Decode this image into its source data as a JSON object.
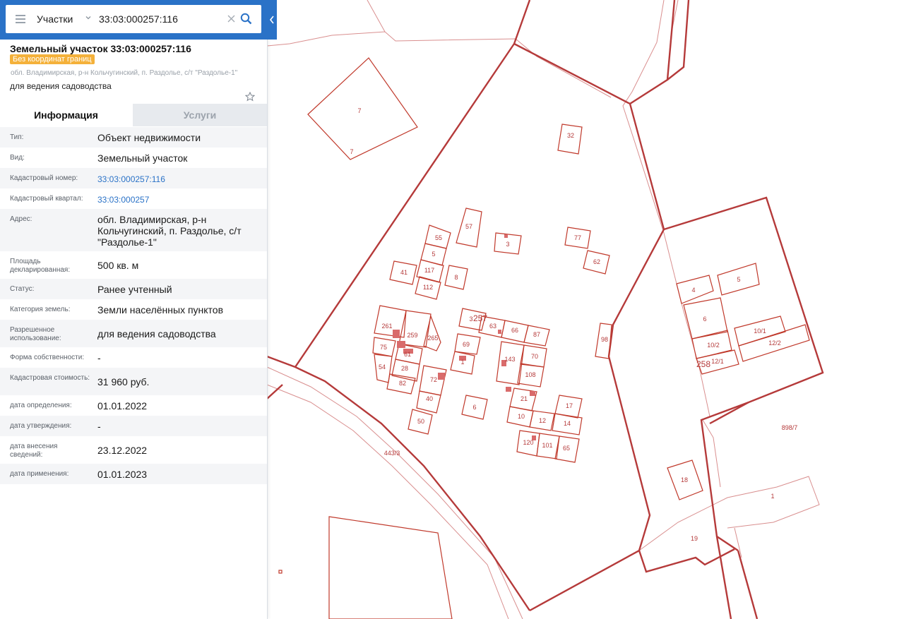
{
  "search": {
    "layer": "Участки",
    "query": "33:03:000257:116"
  },
  "parcel": {
    "title": "Земельный участок 33:03:000257:116",
    "badge": "Без координат границ",
    "address_line": "обл. Владимирская, р-н Кольчугинский, п. Раздолье, с/т \"Раздолье-1\"",
    "purpose_line": "для ведения садоводства"
  },
  "tabs": {
    "info": "Информация",
    "services": "Услуги"
  },
  "info_rows": [
    {
      "label": "Тип:",
      "value": "Объект недвижимости"
    },
    {
      "label": "Вид:",
      "value": "Земельный участок"
    },
    {
      "label": "Кадастровый номер:",
      "value": "33:03:000257:116"
    },
    {
      "label": "Кадастровый квартал:",
      "value": "33:03:000257"
    },
    {
      "label": "Адрес:",
      "value": "обл. Владимирская, р-н Кольчугинский, п. Раздолье, с/т \"Раздолье-1\""
    },
    {
      "label": "Площадь декларированная:",
      "value": "500 кв. м"
    },
    {
      "label": "Статус:",
      "value": "Ранее учтенный"
    },
    {
      "label": "Категория земель:",
      "value": "Земли населённых пунктов"
    },
    {
      "label": "Разрешенное использование:",
      "value": "для ведения садоводства"
    },
    {
      "label": "Форма собственности:",
      "value": "-"
    },
    {
      "label": "Кадастровая стоимость:",
      "value": "31 960 руб."
    },
    {
      "label": "дата определения:",
      "value": "01.01.2022"
    },
    {
      "label": "дата утверждения:",
      "value": "-"
    },
    {
      "label": "дата внесения сведений:",
      "value": "23.12.2022"
    },
    {
      "label": "дата применения:",
      "value": "01.01.2023"
    }
  ],
  "map_labels": {
    "quarter_257": "257",
    "quarter_258": "258",
    "road": "443/3",
    "big_parcel": "898/7",
    "parcels": [
      "7",
      "7",
      "32",
      "55",
      "57",
      "3",
      "77",
      "5",
      "62",
      "41",
      "117",
      "8",
      "112",
      "3",
      "63",
      "66",
      "87",
      "261",
      "259",
      "265",
      "69",
      "75",
      "61",
      "1",
      "143",
      "70",
      "54",
      "28",
      "108",
      "72",
      "82",
      "40",
      "6",
      "21",
      "17",
      "10",
      "12",
      "14",
      "50",
      "120",
      "101",
      "65",
      "98",
      "4",
      "5",
      "6",
      "10/1",
      "10/2",
      "12/1",
      "12/2",
      "18",
      "1",
      "19"
    ]
  },
  "colors": {
    "accent": "#2a72c7",
    "badge": "#f4b13a",
    "map_line": "#b53a3a"
  }
}
